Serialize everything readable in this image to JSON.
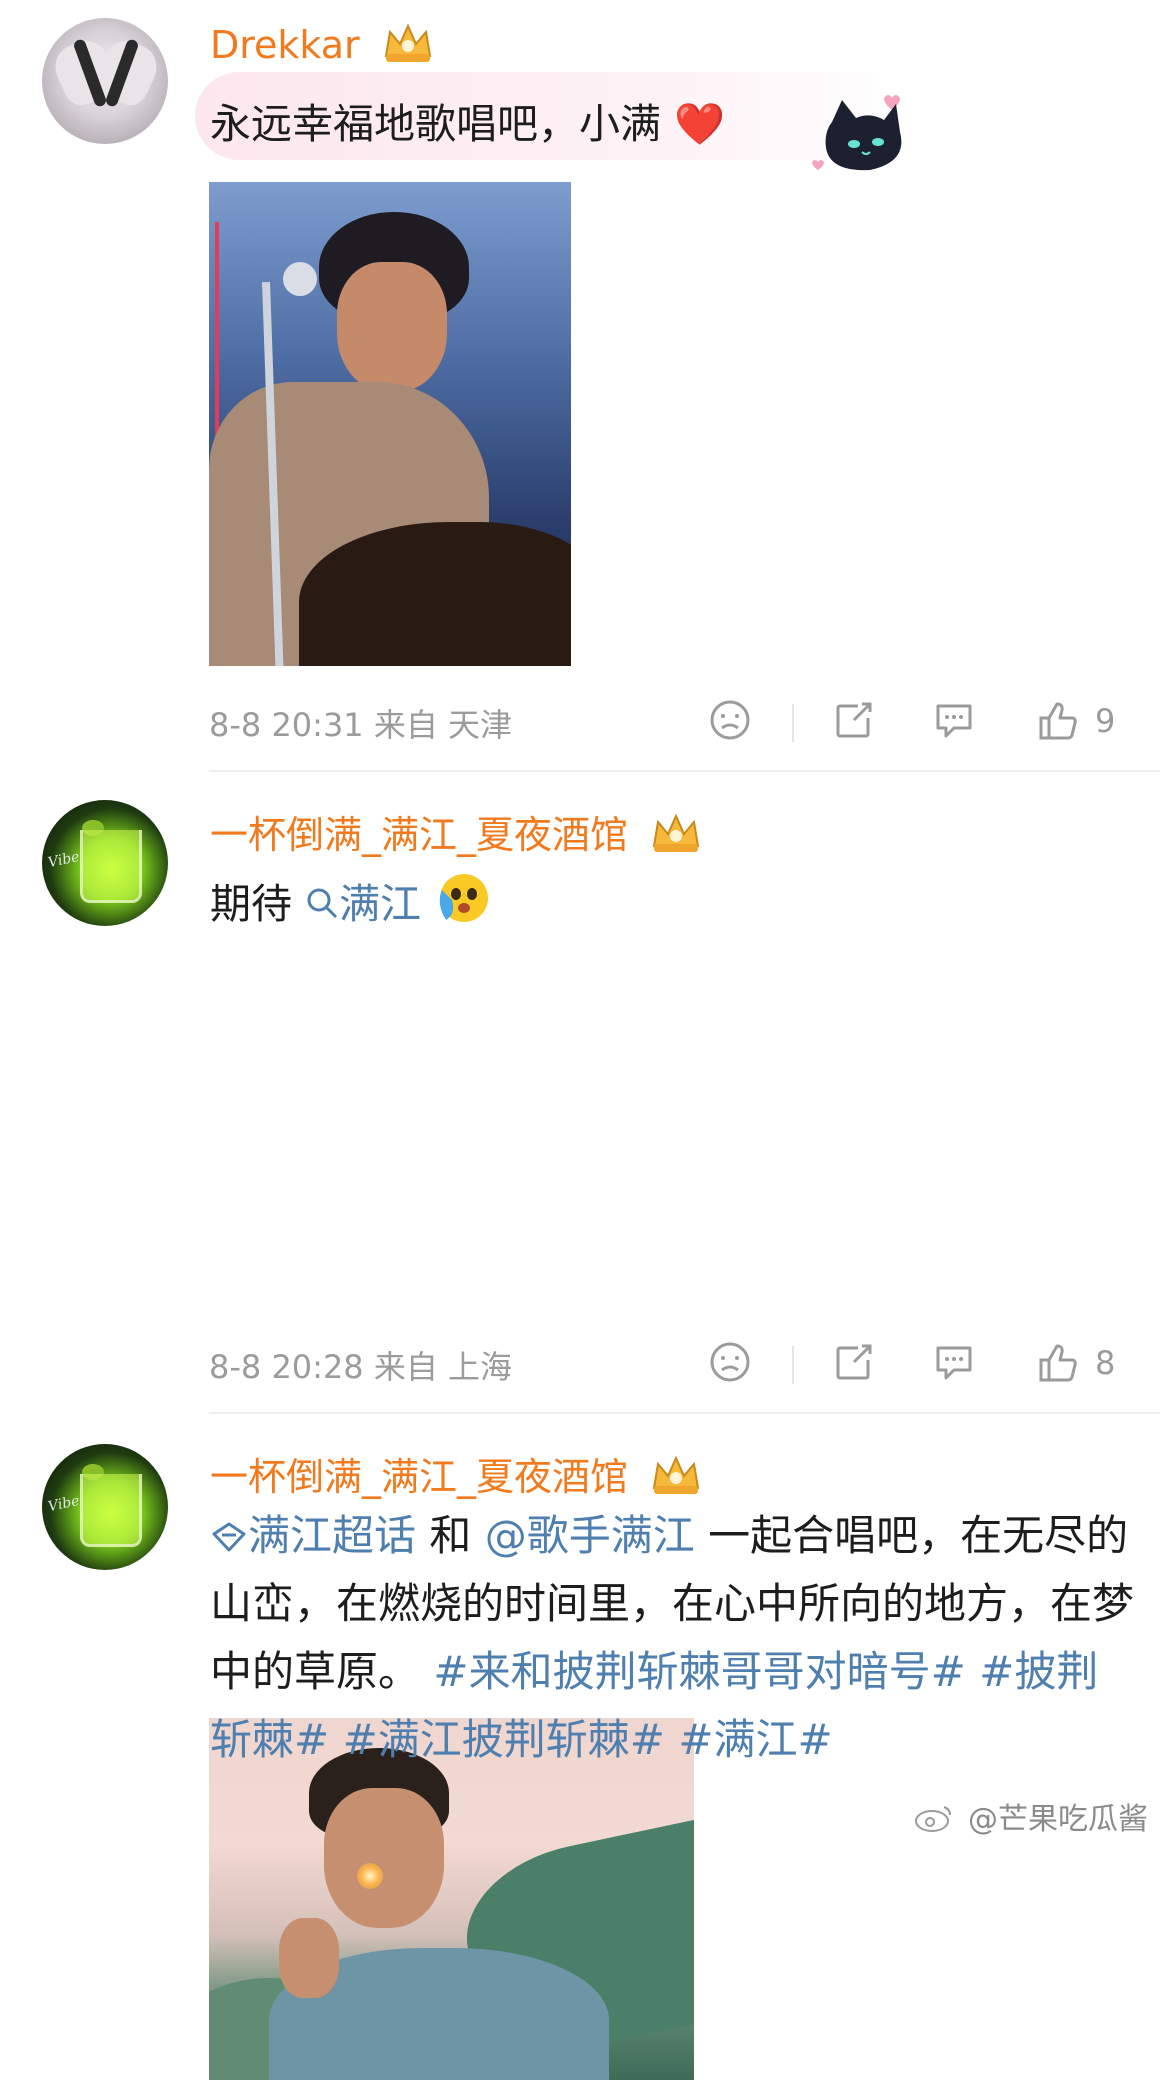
{
  "comments": [
    {
      "username": "Drekkar",
      "text": "永远幸福地歌唱吧，小满",
      "heart_emoji": "❤️",
      "meta": "8-8 20:31 来自 天津",
      "likes": "9"
    },
    {
      "username": "一杯倒满_满江_夏夜酒馆",
      "text_prefix": "期待",
      "search_link": "满江",
      "meta": "8-8 20:28 来自 上海",
      "likes": "8"
    },
    {
      "username": "一杯倒满_满江_夏夜酒馆",
      "supertopic": "满江超话",
      "and_word": " 和 ",
      "mention": "@歌手满江",
      "body_text": " 一起合唱吧，在无尽的山峦，在燃烧的时间里，在心中所向的地方，在梦中的草原。",
      "hashtag1": "#来和披荆斩棘哥哥对暗号#",
      "hashtag2": "#披荆斩棘#",
      "hashtag3": "#满江披荆斩棘#",
      "hashtag4": "#满江#"
    }
  ],
  "watermark": "@芒果吃瓜酱",
  "colors": {
    "username": "#f07a1d",
    "link": "#4f7fae",
    "meta": "#9b9b9b"
  },
  "icons": [
    "crown-icon",
    "dislike-icon",
    "share-icon",
    "comment-icon",
    "like-icon",
    "search-icon",
    "supertopic-icon",
    "weibo-logo-icon"
  ]
}
